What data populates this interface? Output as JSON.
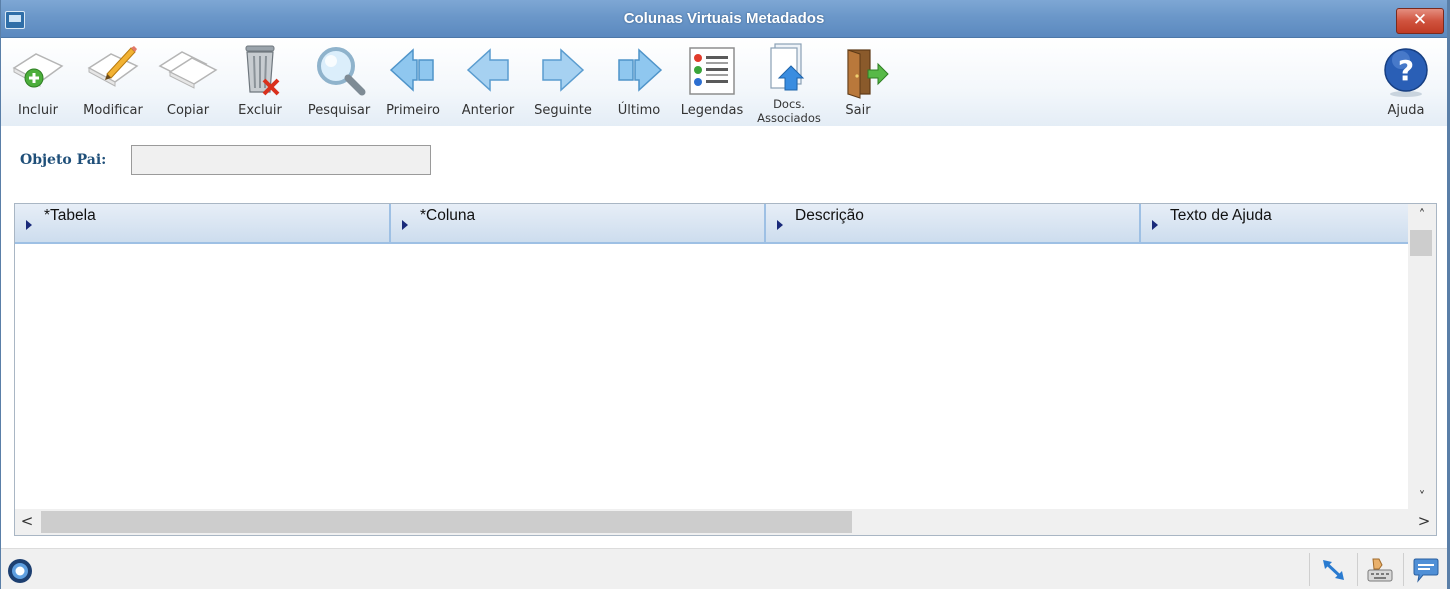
{
  "window": {
    "title": "Colunas Virtuais Metadados",
    "close_label": "✕"
  },
  "toolbar": {
    "buttons": [
      {
        "label": "Incluir",
        "icon": "add-document-icon"
      },
      {
        "label": "Modificar",
        "icon": "edit-document-icon"
      },
      {
        "label": "Copiar",
        "icon": "copy-document-icon"
      },
      {
        "label": "Excluir",
        "icon": "trash-icon"
      },
      {
        "label": "Pesquisar",
        "icon": "magnifier-icon"
      },
      {
        "label": "Primeiro",
        "icon": "first-arrow-icon"
      },
      {
        "label": "Anterior",
        "icon": "previous-arrow-icon"
      },
      {
        "label": "Seguinte",
        "icon": "next-arrow-icon"
      },
      {
        "label": "Último",
        "icon": "last-arrow-icon"
      },
      {
        "label": "Legendas",
        "icon": "legend-list-icon"
      }
    ],
    "docs": {
      "line1": "Docs.",
      "line2": "Associados",
      "icon": "associated-docs-icon"
    },
    "exit": {
      "label": "Sair",
      "icon": "exit-door-icon"
    },
    "help": {
      "label": "Ajuda",
      "icon": "help-question-icon"
    }
  },
  "form": {
    "parent_object_label": "Objeto Pai:",
    "parent_object_value": ""
  },
  "grid": {
    "columns": [
      "*Tabela",
      "*Coluna",
      "Descrição",
      "Texto de Ajuda"
    ],
    "rows": []
  },
  "scroll": {
    "up": "˄",
    "down": "˅",
    "left": "<",
    "right": ">"
  },
  "colors": {
    "title_bar": "#6b97c9",
    "close_button": "#d0533e",
    "header_border": "#9ec0e4",
    "label_text": "#1f4f79"
  }
}
